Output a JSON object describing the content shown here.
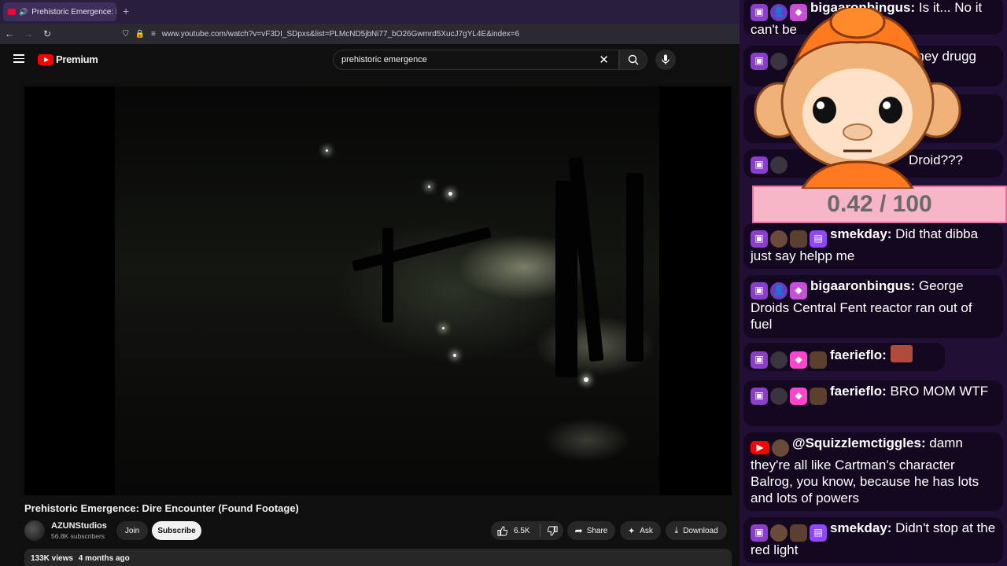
{
  "browser": {
    "tab_title": "Prehistoric Emergence: Dire",
    "url": "www.youtube.com/watch?v=vF3DI_SDpxs&list=PLMcND5jbNi77_bO26Gwmrd5XucJ7gYL4E&index=6"
  },
  "youtube": {
    "logo_text": "Premium",
    "search_value": "prehistoric emergence",
    "video_title": "Prehistoric Emergence: Dire Encounter (Found Footage)",
    "channel_name": "AZUNStudios",
    "subscribers": "56.8K subscribers",
    "join_label": "Join",
    "subscribe_label": "Subscribe",
    "like_count": "6.5K",
    "share_label": "Share",
    "ask_label": "Ask",
    "download_label": "Download",
    "views": "133K views",
    "age": "4 months ago"
  },
  "overlay": {
    "gauge_text": "0.42 / 100",
    "gauge_value": 0.42,
    "gauge_max": 100
  },
  "chat": [
    {
      "user": "bigaaronbingus:",
      "text": "Is it... No it can't be"
    },
    {
      "user": "",
      "text": "They drugg"
    },
    {
      "user": "",
      "text": "Droid???"
    },
    {
      "user": "smekday:",
      "text": "Did that dibba just say helpp me"
    },
    {
      "user": "bigaaronbingus:",
      "text": "George Droids Central Fent reactor ran out of fuel"
    },
    {
      "user": "faerieflo:",
      "text": ""
    },
    {
      "user": "faerieflo:",
      "text": "BRO MOM WTF"
    },
    {
      "user": "@Squizzlemctiggles:",
      "text": "damn they're all like Cartman's character Balrog, you know, because he has lots and lots of powers"
    },
    {
      "user": "smekday:",
      "text": "Didn't stop at the red light"
    }
  ]
}
